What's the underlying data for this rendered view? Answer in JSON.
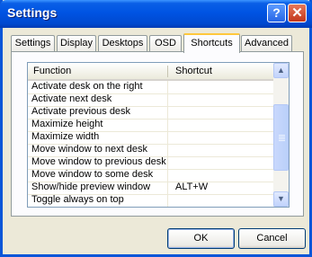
{
  "window": {
    "title": "Settings",
    "help_label": "?",
    "close_label": "✕"
  },
  "tabs": [
    {
      "label": "Settings"
    },
    {
      "label": "Display"
    },
    {
      "label": "Desktops"
    },
    {
      "label": "OSD"
    },
    {
      "label": "Shortcuts",
      "active": true
    },
    {
      "label": "Advanced"
    }
  ],
  "table": {
    "columns": [
      "Function",
      "Shortcut"
    ],
    "rows": [
      {
        "function": "Activate desk on the right",
        "shortcut": ""
      },
      {
        "function": "Activate next desk",
        "shortcut": ""
      },
      {
        "function": "Activate previous desk",
        "shortcut": ""
      },
      {
        "function": "Maximize height",
        "shortcut": ""
      },
      {
        "function": "Maximize width",
        "shortcut": ""
      },
      {
        "function": "Move window to next desk",
        "shortcut": ""
      },
      {
        "function": "Move window to previous desk",
        "shortcut": ""
      },
      {
        "function": "Move window to some desk",
        "shortcut": ""
      },
      {
        "function": "Show/hide preview window",
        "shortcut": "ALT+W"
      },
      {
        "function": "Toggle always on top",
        "shortcut": ""
      }
    ]
  },
  "scrollbar": {
    "up_icon": "▲",
    "down_icon": "▼"
  },
  "buttons": {
    "ok": "OK",
    "cancel": "Cancel"
  }
}
